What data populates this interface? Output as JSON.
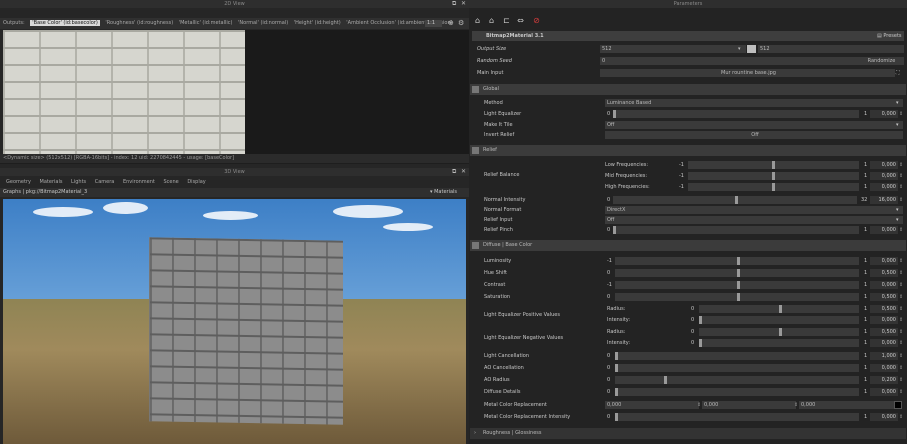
{
  "view2d": {
    "title": "2D View",
    "outputs_label": "Outputs:",
    "channels": [
      "'Base Color' (id:basecolor)",
      "'Roughness' (id:roughness)",
      "'Metallic' (id:metallic)",
      "'Normal' (id:normal)",
      "'Height' (id:height)",
      "'Ambient Occlusion' (id:ambientOcclusion)"
    ],
    "zoom": "1:1",
    "status": "<Dynamic size> (512x512) [RGBA-16bits] - index: 12 uid: 2270842445 - usage: [baseColor]"
  },
  "view3d": {
    "title": "3D View",
    "menu": [
      "Geometry",
      "Materials",
      "Lights",
      "Camera",
      "Environment",
      "Scene",
      "Display"
    ],
    "graph_label": "Graphs | pkg://Bitmap2Material_3",
    "materials_label": "Materials"
  },
  "params": {
    "title": "Parameters",
    "material_name": "Bitmap2Material 3.1",
    "presets_label": "Presets",
    "output_size_label": "Output Size",
    "output_size_a": "512",
    "output_size_b": "512",
    "random_seed_label": "Random Seed",
    "random_seed_value": "0",
    "randomize_label": "Randomize",
    "main_input_label": "Main Input",
    "main_input_value": "Mur rountine base.jpg",
    "sections": {
      "global": "Global",
      "relief": "Relief",
      "diffuse": "Diffuse | Base Color",
      "roughness": "Roughness | Glossiness"
    },
    "global": {
      "method_label": "Method",
      "method_value": "Luminance Based",
      "light_eq_label": "Light Equalizer",
      "light_eq_min": "0",
      "light_eq_max": "1",
      "light_eq_value": "0,000",
      "make_tile_label": "Make It Tile",
      "make_tile_value": "Off",
      "invert_relief_label": "Invert Relief",
      "invert_relief_value": "Off"
    },
    "relief": {
      "balance_label": "Relief Balance",
      "low_label": "Low Frequencies:",
      "mid_label": "Mid Frequencies:",
      "high_label": "High Frequencies:",
      "min": "-1",
      "max": "1",
      "low_value": "0,000",
      "mid_value": "0,000",
      "high_value": "0,000",
      "normal_intensity_label": "Normal Intensity",
      "normal_intensity_min": "0",
      "normal_intensity_max": "32",
      "normal_intensity_value": "16,000",
      "normal_format_label": "Normal Format",
      "normal_format_value": "DirectX",
      "relief_input_label": "Relief Input",
      "relief_input_value": "Off",
      "relief_pinch_label": "Relief Pinch",
      "relief_pinch_min": "0",
      "relief_pinch_max": "1",
      "relief_pinch_value": "0,000"
    },
    "diffuse": {
      "luminosity_label": "Luminosity",
      "luminosity_min": "-1",
      "luminosity_value": "0,000",
      "hue_label": "Hue Shift",
      "hue_min": "0",
      "hue_value": "0,500",
      "contrast_label": "Contrast",
      "contrast_min": "-1",
      "contrast_value": "0,000",
      "saturation_label": "Saturation",
      "saturation_min": "0",
      "saturation_value": "0,500",
      "lepv_label": "Light Equalizer Positive Values",
      "lenv_label": "Light Equalizer Negative Values",
      "radius_label": "Radius:",
      "intensity_label": "Intensity:",
      "lepv_radius": "0,500",
      "lepv_intensity": "0,000",
      "lenv_radius": "0,500",
      "lenv_intensity": "0,000",
      "light_cancel_label": "Light Cancellation",
      "light_cancel_value": "1,000",
      "ao_cancel_label": "AO Cancellation",
      "ao_cancel_value": "0,000",
      "ao_radius_label": "AO Radius",
      "ao_radius_value": "0,200",
      "diffuse_details_label": "Diffuse Details",
      "diffuse_details_value": "0,000",
      "mcr_label": "Metal Color Replacement",
      "mcr_a": "0,000",
      "mcr_b": "0,000",
      "mcr_c": "0,000",
      "mcri_label": "Metal Color Replacement Intensity",
      "mcri_value": "0,000",
      "zero": "0",
      "one": "1"
    }
  }
}
